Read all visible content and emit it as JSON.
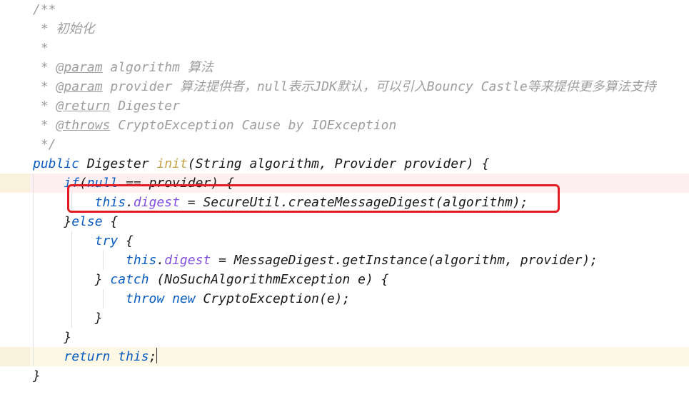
{
  "javadoc": {
    "open": "/**",
    "line_init": " * 初始化",
    "line_blank": " *",
    "param1_prefix": " * ",
    "param1_tag": "@param",
    "param1_name": " algorithm ",
    "param1_desc": "算法",
    "param2_prefix": " * ",
    "param2_tag": "@param",
    "param2_name": " provider ",
    "param2_desc": "算法提供者，null表示JDK默认，可以引入Bouncy Castle等来提供更多算法支持",
    "return_prefix": " * ",
    "return_tag": "@return",
    "return_desc": " Digester",
    "throws_prefix": " * ",
    "throws_tag": "@throws",
    "throws_type": " CryptoException ",
    "throws_desc": "Cause by IOException",
    "close": " */"
  },
  "sig": {
    "kw_public": "public",
    "ret_type": " Digester ",
    "name": "init",
    "params": "(String algorithm, Provider provider) {"
  },
  "l_if": {
    "indent": "    ",
    "kw": "if",
    "open": "(",
    "null_kw": "null",
    "rest": " == provider) {"
  },
  "l_assign1": {
    "indent": "        ",
    "this_kw": "this",
    "dot": ".",
    "field": "digest",
    "eq": " = SecureUtil.",
    "call": "createMessageDigest",
    "tail": "(algorithm);"
  },
  "l_else": {
    "indent": "    ",
    "close": "}",
    "kw": "else",
    "open": " {"
  },
  "l_try": {
    "indent": "        ",
    "kw": "try",
    "open": " {"
  },
  "l_assign2": {
    "indent": "            ",
    "this_kw": "this",
    "dot": ".",
    "field": "digest",
    "eq": " = MessageDigest.",
    "call": "getInstance",
    "tail": "(algorithm, provider);"
  },
  "l_catch": {
    "indent": "        ",
    "close": "} ",
    "kw": "catch",
    "open": " (NoSuchAlgorithmException e) {"
  },
  "l_throw": {
    "indent": "            ",
    "kw_throw": "throw",
    "sp": " ",
    "kw_new": "new",
    "rest": " CryptoException(e);"
  },
  "l_close_try": "        }",
  "l_close_else": "    }",
  "l_return": {
    "indent": "    ",
    "kw": "return",
    "sp": " ",
    "this_kw": "this",
    "semi": ";"
  },
  "l_close_method": "}"
}
